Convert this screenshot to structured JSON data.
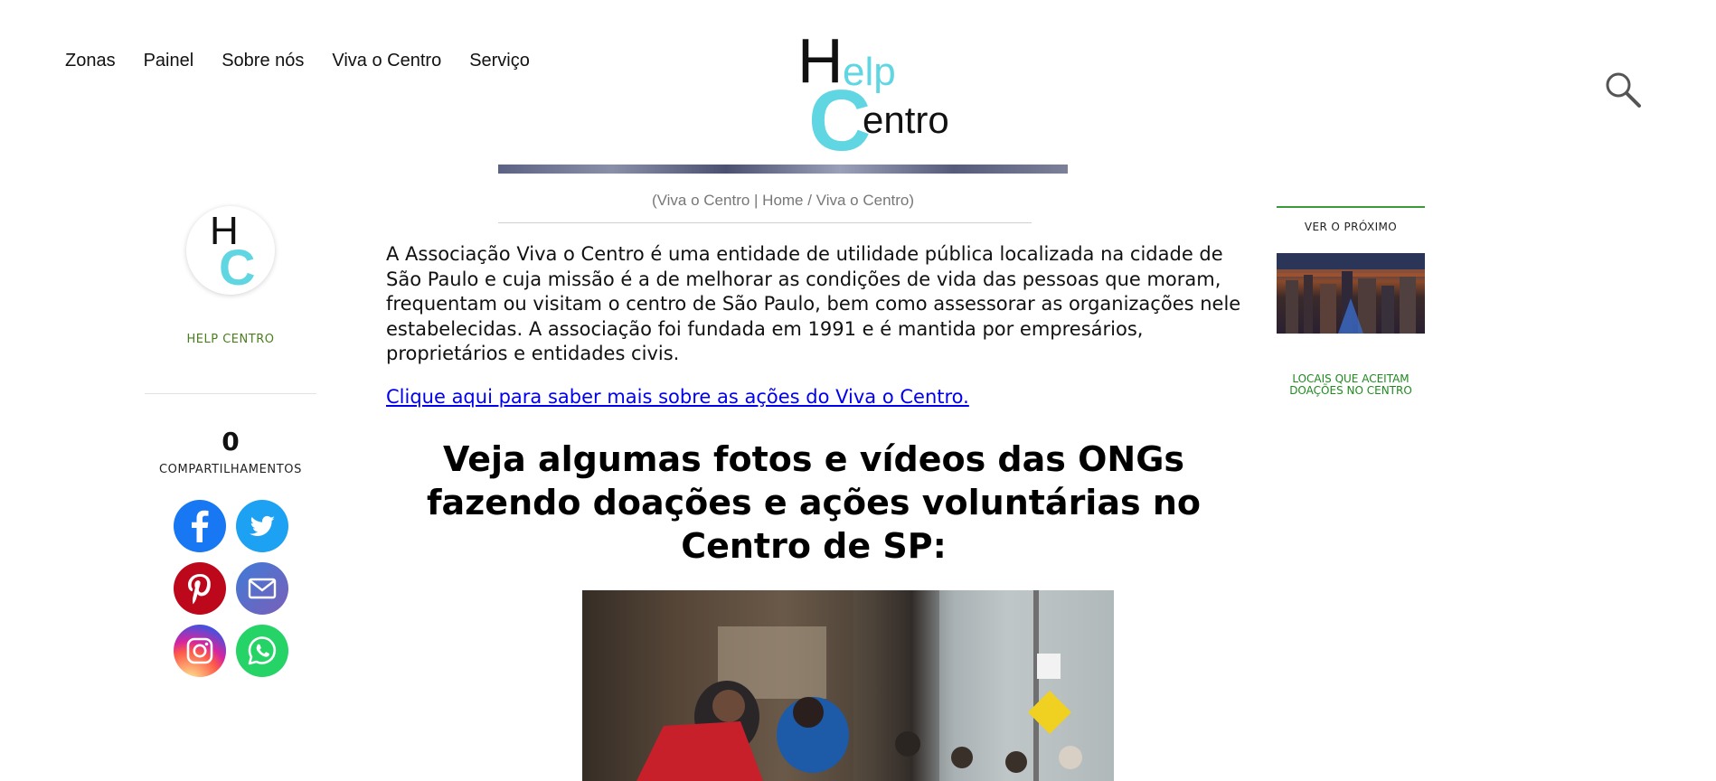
{
  "nav": {
    "items": [
      "Zonas",
      "Painel",
      "Sobre nós",
      "Viva o Centro",
      "Serviço"
    ]
  },
  "logo": {
    "line1_h": "H",
    "line1_rest": "elp",
    "line2_c": "C",
    "line2_rest": "entro"
  },
  "hero": {
    "caption": "(Viva o Centro | Home / Viva o Centro)"
  },
  "author": {
    "avatar_letters": {
      "top": "H",
      "bottom": "C"
    },
    "name": "HELP CENTRO",
    "share_count": "0",
    "share_label": "COMPARTILHAMENTOS"
  },
  "social": [
    {
      "network": "facebook",
      "icon": "facebook-icon",
      "color": "#1877f2"
    },
    {
      "network": "twitter",
      "icon": "twitter-icon",
      "color": "#1da1f2"
    },
    {
      "network": "pinterest",
      "icon": "pinterest-icon",
      "color": "#bd081c"
    },
    {
      "network": "email",
      "icon": "mail-icon",
      "color": "#5a6fd0"
    },
    {
      "network": "instagram",
      "icon": "instagram-icon",
      "color": "#d6249f"
    },
    {
      "network": "whatsapp",
      "icon": "whatsapp-icon",
      "color": "#25d366"
    }
  ],
  "article": {
    "intro": "A Associação Viva o Centro é uma entidade de utilidade pública localizada na cidade de São Paulo e cuja missão é a de melhorar as condições de vida das pessoas que moram, frequentam ou visitam o centro de São Paulo, bem como assessorar as organizações nele estabelecidas. A associação foi fundada em 1991 e é mantida por empresários, proprietários e entidades civis.",
    "link": "Clique aqui para saber mais sobre as ações do Viva o Centro.",
    "heading": "Veja algumas fotos e vídeos das ONGs fazendo doações e ações voluntárias no Centro de SP:"
  },
  "sidebar_right": {
    "label": "VER O PRÓXIMO",
    "next_title": "LOCAIS QUE ACEITAM DOAÇÕES NO CENTRO"
  },
  "colors": {
    "brand_cyan": "#5fd6e2",
    "author_green": "#4a7f1c",
    "next_green": "#1f8a1f",
    "link_blue": "#0000ee"
  }
}
